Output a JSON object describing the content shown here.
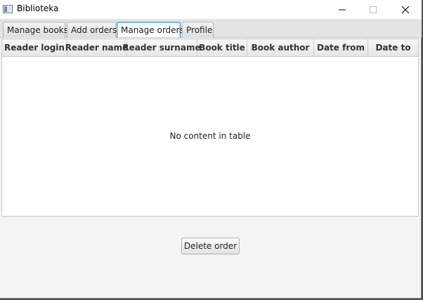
{
  "window": {
    "title": "Biblioteka",
    "icon": "window-app-icon",
    "controls": [
      "minimize-icon",
      "maximize-icon",
      "close-icon"
    ]
  },
  "tabs": [
    {
      "label": "Manage books",
      "selected": false
    },
    {
      "label": "Add orders",
      "selected": false
    },
    {
      "label": "Manage orders",
      "selected": true
    },
    {
      "label": "Profile",
      "selected": false
    }
  ],
  "table": {
    "columns": [
      "Reader login",
      "Reader name",
      "Reader surname",
      "Book title",
      "Book author",
      "Date from",
      "Date to"
    ],
    "rows": [],
    "placeholder": "No content in table"
  },
  "actions": {
    "delete_label": "Delete order"
  },
  "colors": {
    "selected_tab_border": "#3c9fd8",
    "window_background": "#f4f4f4"
  }
}
